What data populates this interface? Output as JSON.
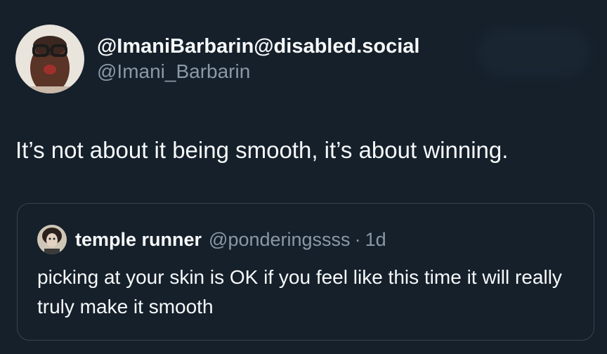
{
  "tweet": {
    "display_name": "@ImaniBarbarin@disabled.social",
    "handle": "@Imani_Barbarin",
    "text": "It’s not about it being smooth, it’s about winning."
  },
  "quoted_tweet": {
    "display_name": "temple runner",
    "handle": "@ponderingssss",
    "separator": "·",
    "time": "1d",
    "text": "picking at your skin is OK if you feel like this time it will really truly make it smooth"
  },
  "colors": {
    "background": "#15202b",
    "text_primary": "#f7f9f9",
    "text_secondary": "#8b98a5",
    "border": "#38444d"
  },
  "icons": {
    "author_avatar": "avatar-photo-icon",
    "quoted_avatar": "avatar-photo-icon"
  }
}
